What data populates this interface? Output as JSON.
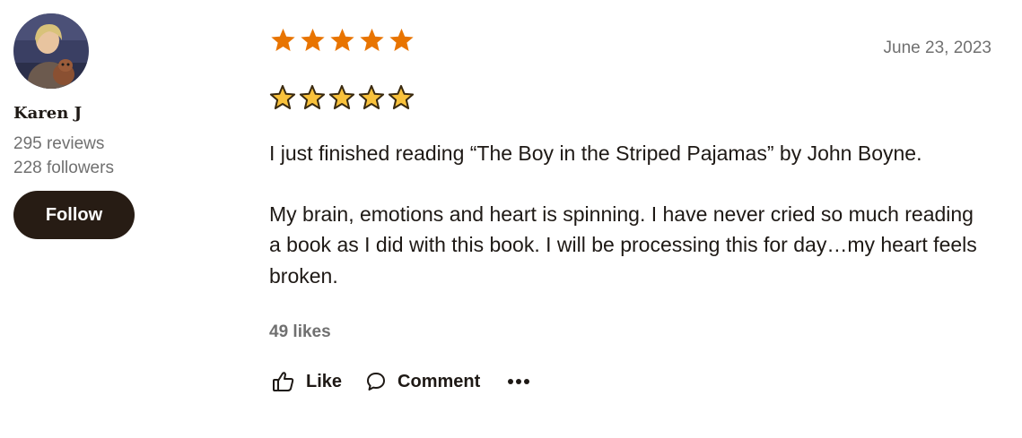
{
  "reviewer": {
    "name": "Karen J",
    "reviews": "295 reviews",
    "followers": "228 followers",
    "follow_label": "Follow",
    "avatar_icon": "profile-photo-person-with-dog"
  },
  "review": {
    "rating": 5,
    "rating_max": 5,
    "star_color": "#e87400",
    "date": "June 23, 2023",
    "emoji_stars_count": 5,
    "emoji_star_icon": "star-emoji",
    "paragraphs": [
      "I just finished reading “The Boy in the Striped Pajamas” by John Boyne.",
      "My brain, emotions and heart is spinning. I have never cried so much reading a book as I did with this book. I will be processing this for day…my heart feels broken."
    ],
    "likes": "49 likes"
  },
  "actions": {
    "like_label": "Like",
    "like_icon": "thumbs-up-icon",
    "comment_label": "Comment",
    "comment_icon": "speech-bubble-icon",
    "more_icon": "more-options-icon"
  }
}
